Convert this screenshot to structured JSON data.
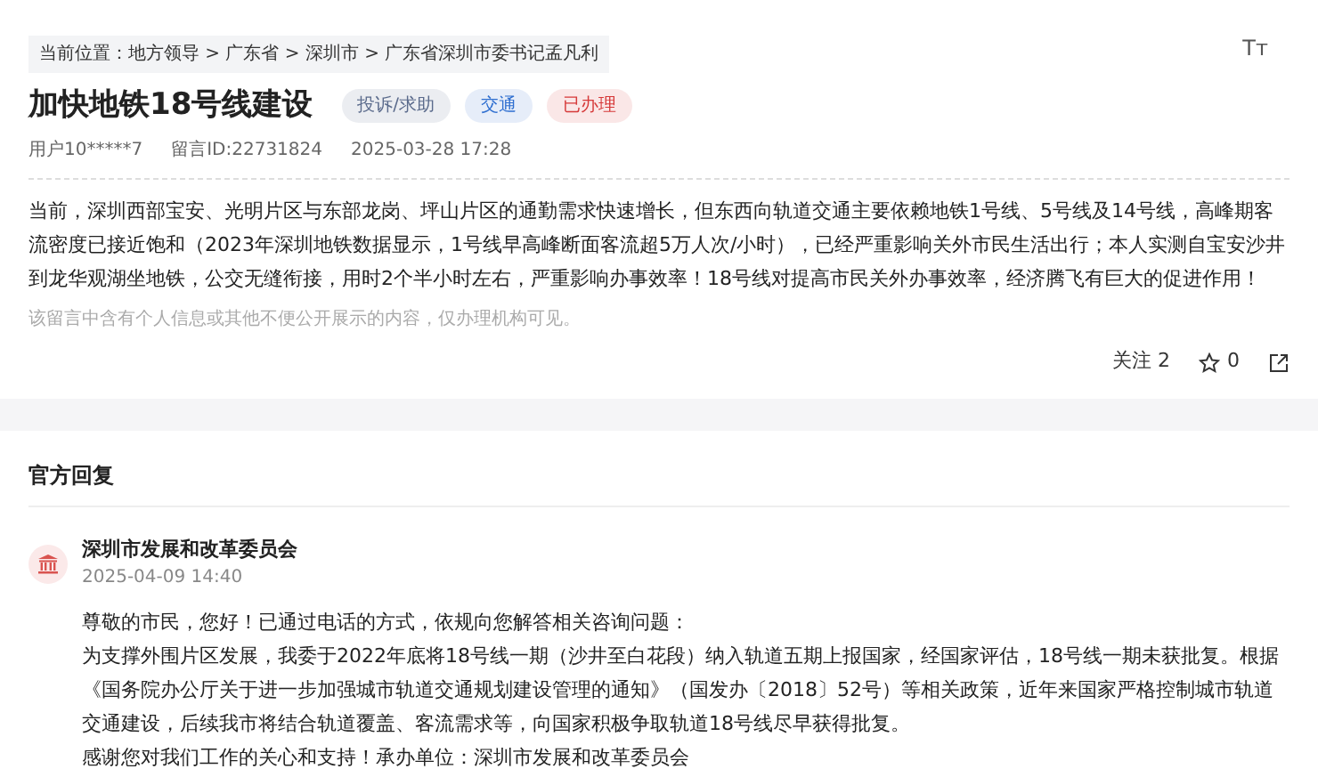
{
  "font_size_button": "Tт",
  "breadcrumb": {
    "label": "当前位置：",
    "items": [
      "地方领导",
      "广东省",
      "深圳市",
      "广东省深圳市委书记孟凡利"
    ],
    "separator": ">"
  },
  "title": "加快地铁18号线建设",
  "tags": [
    {
      "label": "投诉/求助",
      "color": "#5b6b8c"
    },
    {
      "label": "交通",
      "color": "#2f6fd0"
    },
    {
      "label": "已办理",
      "color": "#d63a3a"
    }
  ],
  "meta": [
    "用户10*****7",
    "留言ID:22731824",
    "2025-03-28 17:28"
  ],
  "body": "当前，深圳西部宝安、光明片区与东部龙岗、坪山片区的通勤需求快速增长，但东西向轨道交通主要依赖地铁1号线、5号线及14号线，高峰期客流密度已接近饱和（2023年深圳地铁数据显示，1号线早高峰断面客流超5万人次/小时），已经严重影响关外市民生活出行；本人实测自宝安沙井到龙华观湖坐地铁，公交无缝衔接，用时2个半小时左右，严重影响办事效率！18号线对提高市民关外办事效率，经济腾飞有巨大的促进作用！",
  "privacy_note": "该留言中含有个人信息或其他不便公开展示的内容，仅办理机构可见。",
  "actions": {
    "follow": "关注 2",
    "stars": "0"
  },
  "official_reply": {
    "heading": "官方回复",
    "org": "深圳市发展和改革委员会",
    "date": "2025-04-09 14:40",
    "paragraphs": [
      "尊敬的市民，您好！已通过电话的方式，依规向您解答相关咨询问题：",
      "为支撑外围片区发展，我委于2022年底将18号线一期（沙井至白花段）纳入轨道五期上报国家，经国家评估，18号线一期未获批复。根据《国务院办公厅关于进一步加强城市轨道交通规划建设管理的通知》（国发办〔2018〕52号）等相关政策，近年来国家严格控制城市轨道交通建设，后续我市将结合轨道覆盖、客流需求等，向国家积极争取轨道18号线尽早获得批复。",
      "感谢您对我们工作的关心和支持！承办单位：深圳市发展和改革委员会"
    ]
  }
}
